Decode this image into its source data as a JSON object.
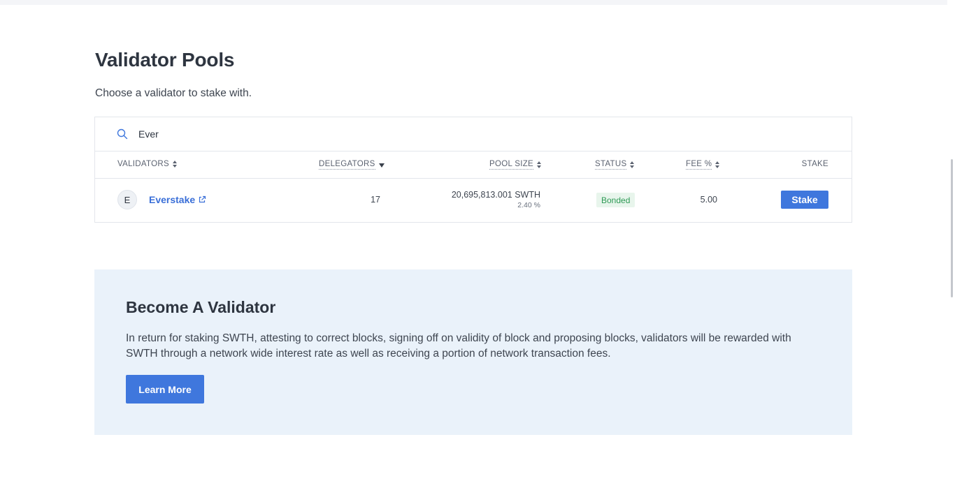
{
  "header": {
    "title": "Validator Pools",
    "subtitle": "Choose a validator to stake with."
  },
  "search": {
    "value": "Ever",
    "placeholder": ""
  },
  "table": {
    "columns": {
      "validators": "VALIDATORS",
      "delegators": "DELEGATORS",
      "pool_size": "POOL SIZE",
      "status": "STATUS",
      "fee": "FEE %",
      "stake": "STAKE"
    },
    "sort": {
      "column": "delegators",
      "direction": "desc"
    },
    "rows": [
      {
        "avatar_letter": "E",
        "name": "Everstake",
        "delegators": "17",
        "pool_size": "20,695,813.001 SWTH",
        "pool_share": "2.40 %",
        "status": "Bonded",
        "fee": "5.00",
        "action_label": "Stake"
      }
    ]
  },
  "promo": {
    "title": "Become A Validator",
    "text": "In return for staking SWTH, attesting to correct blocks, signing off on validity of block and proposing blocks, validators will be rewarded with SWTH through a network wide interest rate as well as receiving a portion of network transaction fees.",
    "button_label": "Learn More"
  },
  "colors": {
    "accent": "#3f77dd",
    "status_bonded_bg": "#e8f5ec",
    "status_bonded_text": "#2e9a55",
    "promo_bg": "#eaf2fa"
  },
  "icons": {
    "search": "search-icon",
    "external_link": "external-link-icon",
    "sort": "sort-icon"
  }
}
